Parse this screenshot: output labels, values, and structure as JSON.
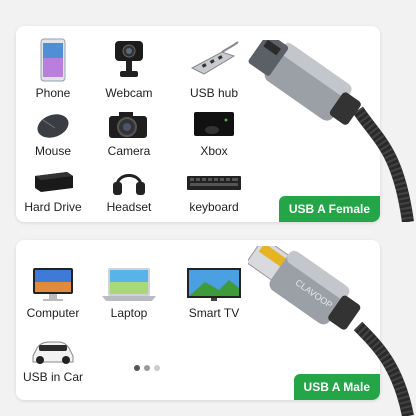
{
  "top_card": {
    "items": [
      {
        "label": "Phone",
        "icon": "phone-icon"
      },
      {
        "label": "Webcam",
        "icon": "webcam-icon"
      },
      {
        "label": "USB hub",
        "icon": "usb-hub-icon"
      },
      {
        "label": "Mouse",
        "icon": "mouse-icon"
      },
      {
        "label": "Camera",
        "icon": "camera-icon"
      },
      {
        "label": "Xbox",
        "icon": "xbox-icon"
      },
      {
        "label": "Hard Drive",
        "icon": "hard-drive-icon"
      },
      {
        "label": "Headset",
        "icon": "headset-icon"
      },
      {
        "label": "keyboard",
        "icon": "keyboard-icon"
      }
    ],
    "badge": "USB A Female"
  },
  "bottom_card": {
    "items": [
      {
        "label": "Computer",
        "icon": "computer-icon"
      },
      {
        "label": "Laptop",
        "icon": "laptop-icon"
      },
      {
        "label": "Smart TV",
        "icon": "smart-tv-icon"
      },
      {
        "label": "USB in Car",
        "icon": "car-icon"
      }
    ],
    "badge": "USB A Male",
    "brand_text": "CLAVOOP"
  },
  "colors": {
    "badge_green": "#23a548",
    "cable_gray": "#8d9196",
    "braid": "#2a2a2a"
  }
}
